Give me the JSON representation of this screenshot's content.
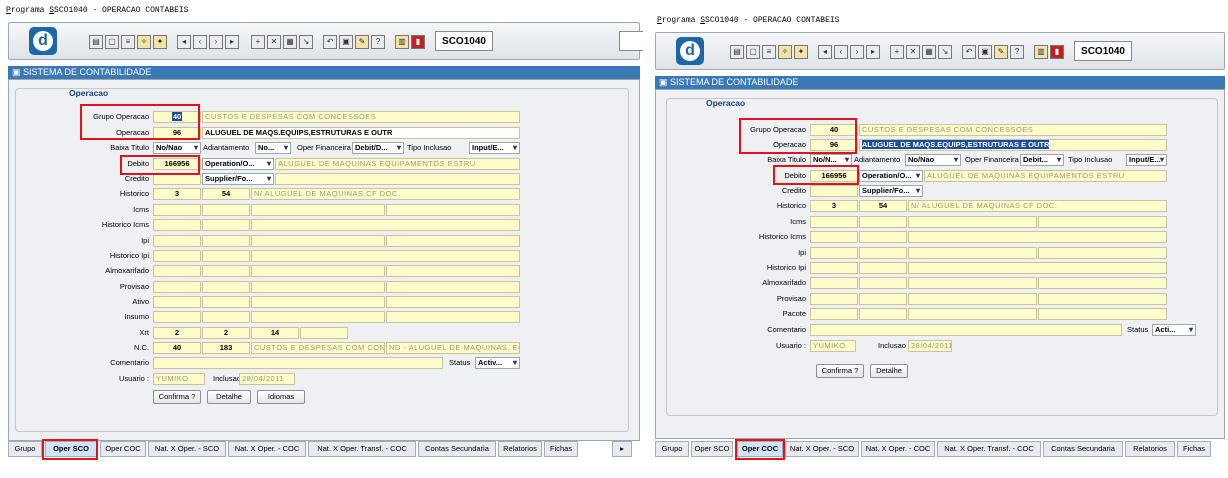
{
  "window_title": "SCO1040 - OPERACAO CONTABEIS",
  "program_label_first": "P",
  "program_label_rest": "rograma",
  "form_name": "SCO1040",
  "system_title": "SISTEMA DE CONTABILIDADE",
  "group_title": "Operacao",
  "labels": {
    "grupo_operacao": "Grupo Operacao",
    "operacao": "Operacao",
    "baixa_titulo": "Baixa Titulo",
    "adiantamento": "Adiantamento",
    "oper_financeira": "Oper Financeira",
    "tipo_inclusao": "Tipo Inclusao",
    "debito": "Debito",
    "credito": "Credito",
    "historico": "Historico",
    "icms": "Icms",
    "historico_icms": "Historico Icms",
    "ipi": "Ipi",
    "historico_ipi": "Historico Ipi",
    "almoxarifado": "Almoxarifado",
    "provisao": "Provisao",
    "ativo": "Ativo",
    "insumo": "Insumo",
    "pacote": "Pacote",
    "xrt": "Xrt",
    "nc": "N.C.",
    "comentario": "Comentario",
    "status": "Status",
    "usuario": "Usuario :",
    "inclusao": "Inclusao"
  },
  "values": {
    "grupo_operacao": "40",
    "grupo_operacao_desc": "CUSTOS E DESPESAS COM CONCESSOES",
    "operacao": "96",
    "operacao_desc": "ALUGUEL DE MAQS.EQUIPS,ESTRUTURAS E OUTR",
    "debito": "166956",
    "debito_desc": "ALUGUEL DE MAQUINAS EQUIPAMENTOS ESTRU",
    "historico_a": "3",
    "historico_b": "54",
    "historico_desc": "N/ ALUGUEL DE MAQUINAS CF DOC.",
    "xrt_a": "2",
    "xrt_b": "2",
    "xrt_c": "14",
    "nc_a": "40",
    "nc_b": "183",
    "nc_desc1": "CUSTOS E DESPESAS COM CONC",
    "nc_desc2": "ND - ALUGUEL DE MAQUINAS, EQ",
    "usuario": "YUMIKO",
    "inclusao": "28/04/2011"
  },
  "left_dropdowns": {
    "baixa_titulo": "No/Nao",
    "adiantamento": "No...",
    "oper_financeira": "Debit/D...",
    "tipo_inclusao": "Input/E...",
    "debito_type": "Operation/O...",
    "credito_type": "Supplier/Fo...",
    "status": "Activ..."
  },
  "right_dropdowns": {
    "baixa_titulo": "No/N...",
    "adiantamento": "No/Nao",
    "oper_financeira": "Debit...",
    "tipo_inclusao": "Input/E...",
    "debito_type": "Operation/O...",
    "credito_type": "Supplier/Fo...",
    "status": "Acti..."
  },
  "buttons": {
    "confirma": "Confirma ?",
    "detalhe": "Detalhe",
    "idiomas": "Idiomas"
  },
  "left_tabs": [
    "Grupo",
    "Oper SCO",
    "Oper COC",
    "Nat. X Oper. - SCO",
    "Nat. X Oper. - COC",
    "Nat. X Oper. Transf. - COC",
    "Contas Secundaria",
    "Relatorios",
    "Fichas"
  ],
  "right_tabs": [
    "Grupo",
    "Oper SCO",
    "Oper COC",
    "Nat. X Oper. - SCO",
    "Nat. X Oper. - COC",
    "Nat. X Oper. Transf. - COC",
    "Contas Secundaria",
    "Relatorios",
    "Fichas"
  ],
  "left_active_tab": "Oper SCO",
  "right_active_tab": "Oper COC",
  "colors": {
    "highlight": "#e0151b",
    "field": "#fffccb",
    "accent": "#3b78b6"
  }
}
